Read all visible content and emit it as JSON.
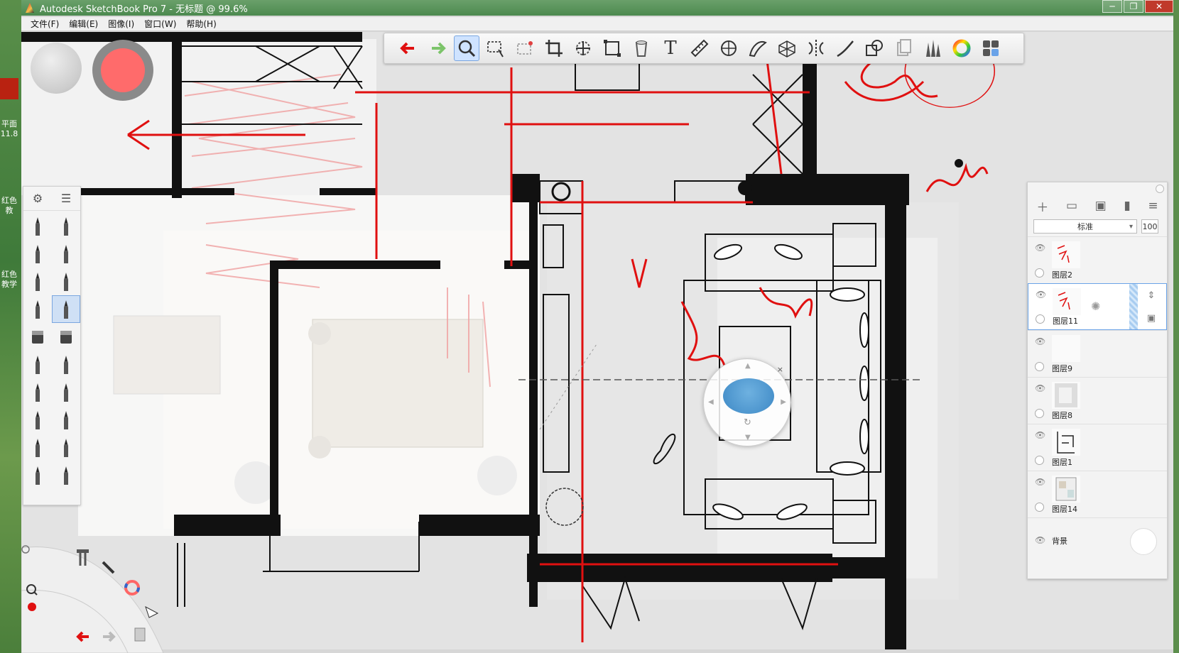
{
  "window": {
    "title": "Autodesk SketchBook Pro 7 - 无标题 @ 99.6%",
    "controls": [
      "─",
      "❐",
      "✕"
    ]
  },
  "desktop": {
    "left_fragments": [
      "平面",
      "11.8",
      "红色",
      "教",
      "红色",
      "教学"
    ]
  },
  "menu": {
    "items": [
      "文件(F)",
      "编辑(E)",
      "图像(I)",
      "窗口(W)",
      "帮助(H)"
    ]
  },
  "toolbar": {
    "tools": [
      {
        "name": "undo-icon",
        "active": false
      },
      {
        "name": "redo-icon",
        "active": false
      },
      {
        "name": "zoom-icon",
        "active": true
      },
      {
        "name": "select-icon",
        "active": false
      },
      {
        "name": "select-magic-icon",
        "active": false
      },
      {
        "name": "crop-icon",
        "active": false
      },
      {
        "name": "transform-icon",
        "active": false
      },
      {
        "name": "distort-icon",
        "active": false
      },
      {
        "name": "fill-bucket-icon",
        "active": false
      },
      {
        "name": "text-icon",
        "active": false
      },
      {
        "name": "ruler-icon",
        "active": false
      },
      {
        "name": "ellipse-icon",
        "active": false
      },
      {
        "name": "french-curve-icon",
        "active": false
      },
      {
        "name": "perspective-icon",
        "active": false
      },
      {
        "name": "symmetry-icon",
        "active": false
      },
      {
        "name": "stroke-icon",
        "active": false
      },
      {
        "name": "shapes-icon",
        "active": false
      },
      {
        "name": "copic-icon",
        "active": false
      },
      {
        "name": "brush-library-icon",
        "active": false
      },
      {
        "name": "color-wheel-icon",
        "active": false
      },
      {
        "name": "grid-view-icon",
        "active": false
      }
    ],
    "text_tool_label": "T"
  },
  "brush_palette": {
    "header_icons": [
      "sliders-icon",
      "list-icon"
    ],
    "brushes": [
      "pencil-brush",
      "technical-pen-brush",
      "marker-brush",
      "felt-pen-brush",
      "ballpoint-brush",
      "fine-pencil-brush",
      "pen-brush",
      "ink-pen-brush",
      "eraser-hard-brush",
      "eraser-soft-brush",
      "airbrush-brush",
      "airbrush-fine-brush",
      "chisel-brush",
      "chisel-fine-brush",
      "marker-thick-brush",
      "fill-brush",
      "round-paint-brush",
      "flat-paint-brush",
      "large-brush",
      "fan-brush"
    ],
    "active_index": 7
  },
  "layers": {
    "blend_mode": "标准",
    "opacity": "100",
    "toolbar_icons": [
      "add-layer-icon",
      "folder-icon",
      "image-icon",
      "lock-icon",
      "menu-icon"
    ],
    "items": [
      {
        "name": "图层2",
        "selected": false,
        "thumb": "red-marks"
      },
      {
        "name": "图层11",
        "selected": true,
        "thumb": "red-marks"
      },
      {
        "name": "图层9",
        "selected": false,
        "thumb": "empty"
      },
      {
        "name": "图层8",
        "selected": false,
        "thumb": "grey"
      },
      {
        "name": "图层1",
        "selected": false,
        "thumb": "plan"
      },
      {
        "name": "图层14",
        "selected": false,
        "thumb": "plan-color"
      }
    ],
    "background_label": "背景"
  },
  "canvas": {
    "zoom": "99.6%"
  },
  "colors": {
    "accent": "#ff6b6b",
    "red_ink": "#e01010",
    "selection": "#6aa3e8"
  }
}
